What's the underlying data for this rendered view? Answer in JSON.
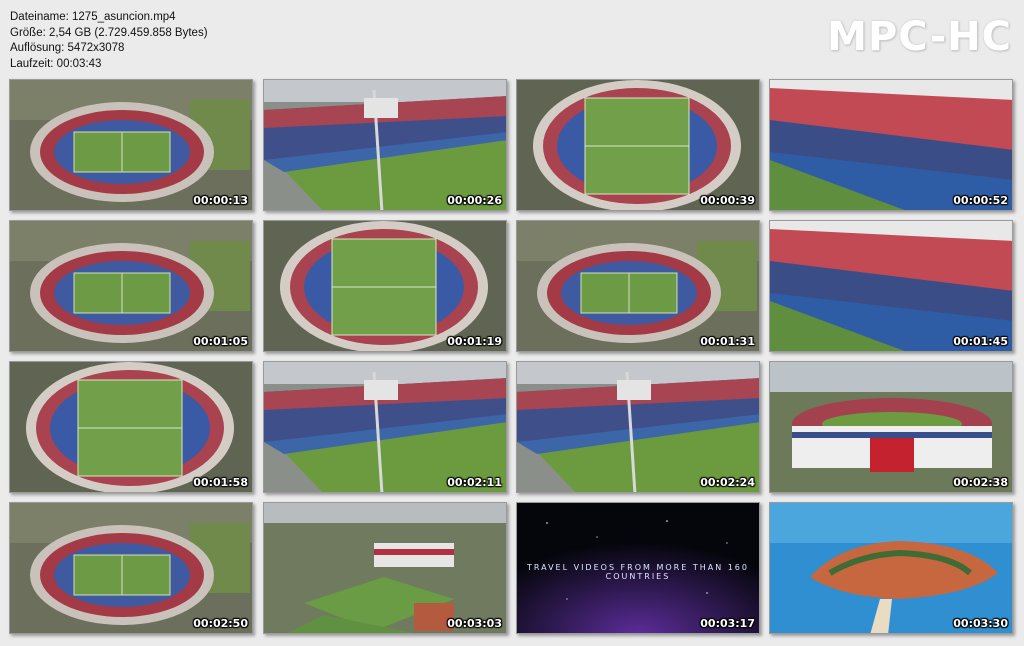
{
  "info": {
    "filename": "Dateiname: 1275_asuncion.mp4",
    "size": "Größe: 2,54 GB (2.729.459.858 Bytes)",
    "resolution": "Auflösung: 5472x3078",
    "duration": "Laufzeit: 00:03:43"
  },
  "brand": "MPC-HC",
  "thumbnails": [
    {
      "time": "00:00:13",
      "scene": "stadium-aerial"
    },
    {
      "time": "00:00:26",
      "scene": "stadium-side"
    },
    {
      "time": "00:00:39",
      "scene": "stadium-top"
    },
    {
      "time": "00:00:52",
      "scene": "stadium-stands"
    },
    {
      "time": "00:01:05",
      "scene": "stadium-aerial"
    },
    {
      "time": "00:01:19",
      "scene": "stadium-top"
    },
    {
      "time": "00:01:31",
      "scene": "stadium-aerial"
    },
    {
      "time": "00:01:45",
      "scene": "stadium-stands"
    },
    {
      "time": "00:01:58",
      "scene": "stadium-top"
    },
    {
      "time": "00:02:11",
      "scene": "stadium-side"
    },
    {
      "time": "00:02:24",
      "scene": "stadium-side"
    },
    {
      "time": "00:02:38",
      "scene": "stadium-front"
    },
    {
      "time": "00:02:50",
      "scene": "stadium-aerial"
    },
    {
      "time": "00:03:03",
      "scene": "city-field"
    },
    {
      "time": "00:03:17",
      "scene": "space-title",
      "caption": "TRAVEL VIDEOS FROM MORE THAN 160 COUNTRIES"
    },
    {
      "time": "00:03:30",
      "scene": "island"
    }
  ]
}
